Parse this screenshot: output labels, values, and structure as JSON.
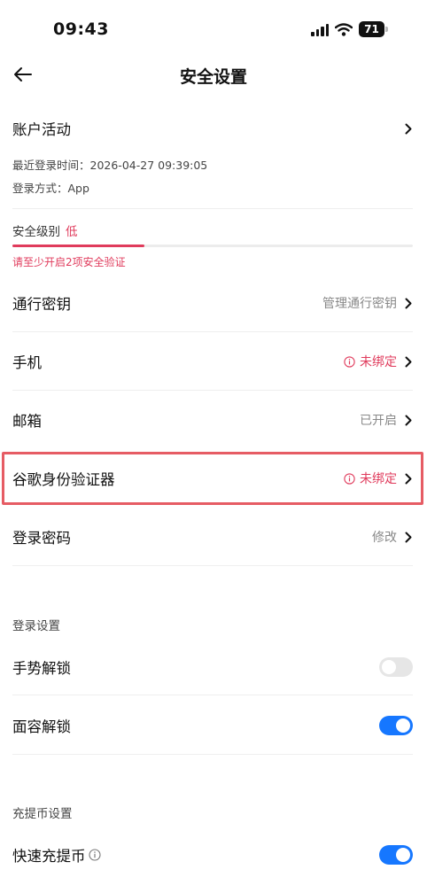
{
  "status_bar": {
    "time": "09:43",
    "battery": "71"
  },
  "header": {
    "title": "安全设置"
  },
  "account_activity": {
    "label": "账户活动",
    "last_login": "最近登录时间：2026-04-27 09:39:05",
    "login_method": "登录方式：App"
  },
  "security_level": {
    "label": "安全级别",
    "value": "低",
    "progress_fraction": 0.33,
    "hint": "请至少开启2项安全验证"
  },
  "items": [
    {
      "label": "通行密钥",
      "value": "管理通行密钥",
      "status": "normal"
    },
    {
      "label": "手机",
      "value": "未绑定",
      "status": "warning"
    },
    {
      "label": "邮箱",
      "value": "已开启",
      "status": "normal"
    },
    {
      "label": "谷歌身份验证器",
      "value": "未绑定",
      "status": "warning",
      "highlighted": true
    },
    {
      "label": "登录密码",
      "value": "修改",
      "status": "normal"
    }
  ],
  "login_settings": {
    "title": "登录设置",
    "gesture_unlock": {
      "label": "手势解锁",
      "enabled": false
    },
    "face_unlock": {
      "label": "面容解锁",
      "enabled": true
    }
  },
  "deposit_settings": {
    "title": "充提币设置",
    "quick_deposit": {
      "label": "快速充提币",
      "enabled": true
    }
  },
  "colors": {
    "accent_blue": "#1677ff",
    "warning_red": "#e03b5c",
    "highlight_border": "#e65c64"
  }
}
